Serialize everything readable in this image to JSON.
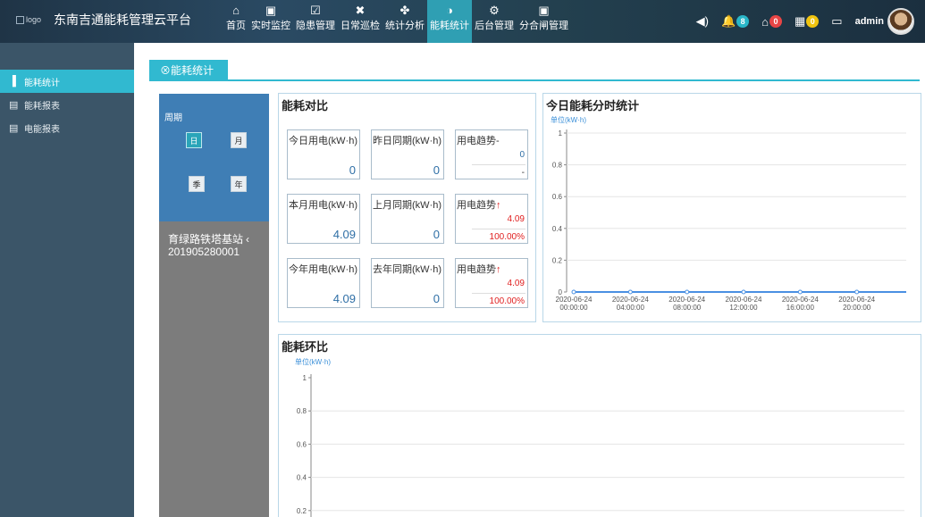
{
  "header": {
    "logo_alt": "logo",
    "title": "东南吉通能耗管理云平台",
    "nav": [
      {
        "label": "首页",
        "icon": "home-icon",
        "glyph": "⌂"
      },
      {
        "label": "实时监控",
        "icon": "monitor-icon",
        "glyph": "▣"
      },
      {
        "label": "隐患管理",
        "icon": "checklist-icon",
        "glyph": "☑"
      },
      {
        "label": "日常巡检",
        "icon": "tools-icon",
        "glyph": "✖"
      },
      {
        "label": "统计分析",
        "icon": "fan-icon",
        "glyph": "✤"
      },
      {
        "label": "能耗统计",
        "icon": "energy-icon",
        "glyph": "◑"
      },
      {
        "label": "后台管理",
        "icon": "gears-icon",
        "glyph": "⚙"
      },
      {
        "label": "分合闸管理",
        "icon": "switch-monitor-icon",
        "glyph": "▣"
      }
    ],
    "active_nav": "能耗统计",
    "notifications": [
      {
        "icon": "bell-icon",
        "glyph": "🔔",
        "count": "8",
        "color": "#29b6c8"
      },
      {
        "icon": "house-alert-icon",
        "glyph": "⌂",
        "count": "0",
        "color": "#e84545"
      },
      {
        "icon": "calendar-icon",
        "glyph": "▦",
        "count": "0",
        "color": "#f1c40f"
      }
    ],
    "user": "admin"
  },
  "sidebar": {
    "items": [
      {
        "label": "能耗统计",
        "icon": "bar-chart-icon",
        "glyph": "▐",
        "active": true
      },
      {
        "label": "能耗报表",
        "icon": "report-icon",
        "glyph": "▤",
        "active": false
      },
      {
        "label": "电能报表",
        "icon": "report-icon",
        "glyph": "▤",
        "active": false
      }
    ]
  },
  "page": {
    "tab_label": "⊗能耗统计"
  },
  "selector": {
    "period_label": "周期",
    "periods": [
      "日",
      "月",
      "季",
      "年"
    ],
    "active_period": "日",
    "site_name": "育绿路铁塔基站",
    "site_id": "201905280001",
    "expand_glyph": "‹"
  },
  "compare": {
    "title": "能耗对比",
    "rows": [
      {
        "current_label": "今日用电(kW·h)",
        "current_value": "0",
        "previous_label": "昨日同期(kW·h)",
        "previous_value": "0",
        "trend_label": "用电趋势",
        "trend_arrow": "-",
        "trend_value": "0",
        "trend_pct": "-"
      },
      {
        "current_label": "本月用电(kW·h)",
        "current_value": "4.09",
        "previous_label": "上月同期(kW·h)",
        "previous_value": "0",
        "trend_label": "用电趋势",
        "trend_arrow": "↑",
        "trend_value": "4.09",
        "trend_pct": "100.00%"
      },
      {
        "current_label": "今年用电(kW·h)",
        "current_value": "4.09",
        "previous_label": "去年同期(kW·h)",
        "previous_value": "0",
        "trend_label": "用电趋势",
        "trend_arrow": "↑",
        "trend_value": "4.09",
        "trend_pct": "100.00%"
      }
    ]
  },
  "chart_data": [
    {
      "type": "line",
      "title": "今日能耗分时统计",
      "unit": "单位(kW·h)",
      "x": [
        "2020-06-24 00:00:00",
        "2020-06-24 04:00:00",
        "2020-06-24 08:00:00",
        "2020-06-24 12:00:00",
        "2020-06-24 16:00:00",
        "2020-06-24 20:00:00"
      ],
      "values": [
        0,
        0,
        0,
        0,
        0,
        0
      ],
      "ylim": [
        0,
        1
      ],
      "yticks": [
        "0",
        "0.2",
        "0.4",
        "0.6",
        "0.8",
        "1"
      ],
      "grid": true,
      "color": "#4a90e2"
    },
    {
      "type": "bar",
      "title": "能耗环比",
      "unit": "单位(kW·h)",
      "ylim": [
        0,
        1
      ],
      "yticks": [
        "0.2",
        "0.4",
        "0.6",
        "0.8",
        "1"
      ],
      "grid": true
    }
  ]
}
